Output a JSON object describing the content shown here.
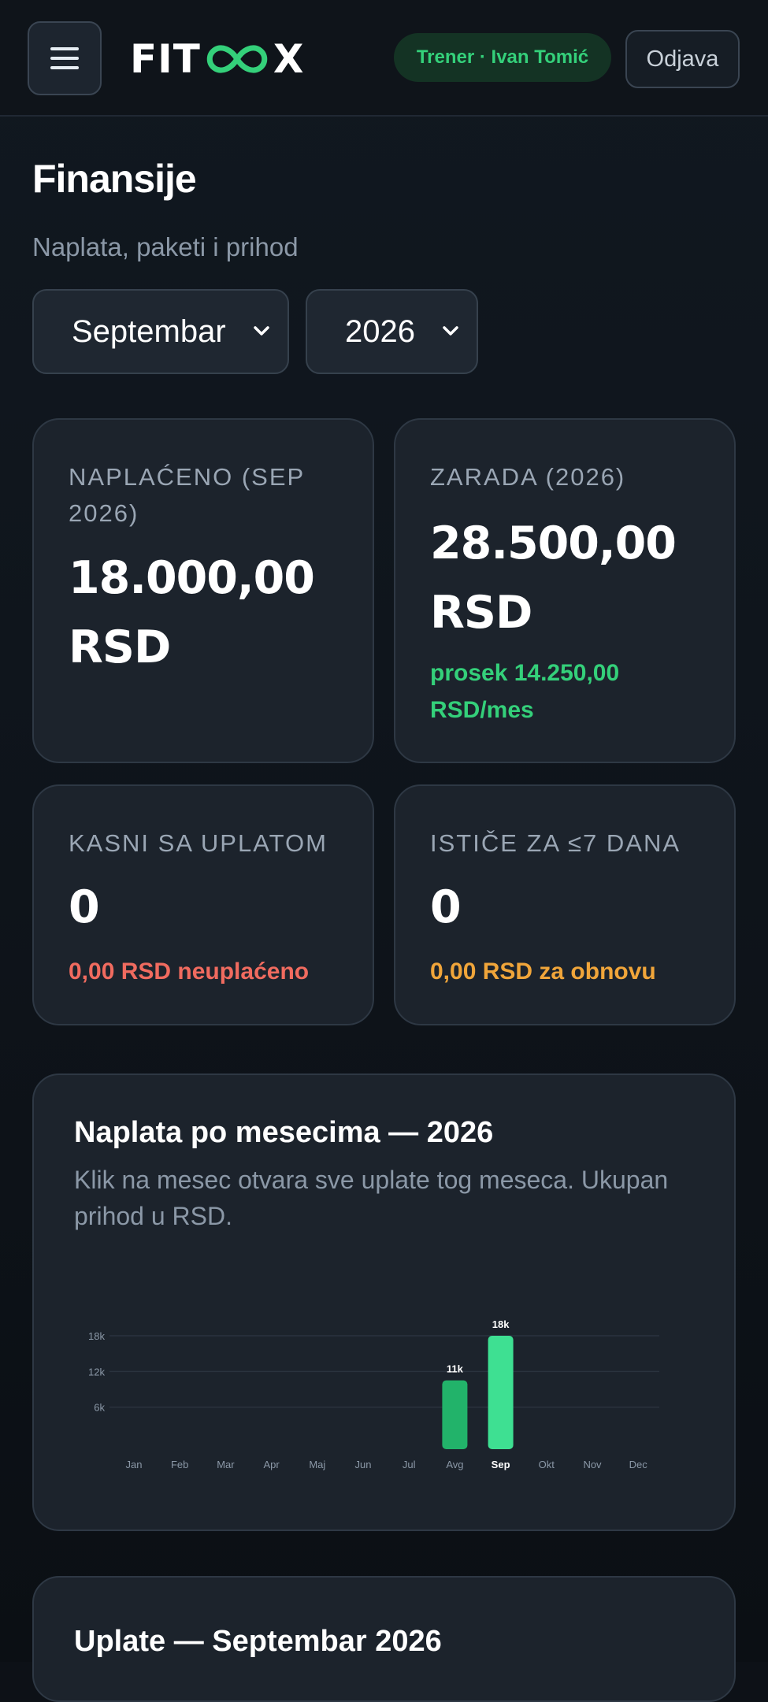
{
  "header": {
    "logo_left": "FIT",
    "logo_right": "X",
    "user_badge": "Trener · Ivan Tomić",
    "logout_label": "Odjava"
  },
  "page": {
    "title": "Finansije",
    "subtitle": "Naplata, paketi i prihod",
    "month_select": "Septembar",
    "year_select": "2026"
  },
  "stats": {
    "collected": {
      "label": "NAPLAĆENO (SEP 2026)",
      "value": "18.000,00 RSD"
    },
    "earnings": {
      "label": "ZARADA (2026)",
      "value": "28.500,00 RSD",
      "note": "prosek 14.250,00 RSD/mes"
    },
    "late": {
      "label": "KASNI SA UPLATOM",
      "value": "0",
      "note": "0,00 RSD neuplaćeno"
    },
    "expiring": {
      "label": "ISTIČE ZA ≤7 DANA",
      "value": "0",
      "note": "0,00 RSD za obnovu"
    }
  },
  "chart_section": {
    "title": "Naplata po mesecima — 2026",
    "subtitle": "Klik na mesec otvara sve uplate tog meseca. Ukupan prihod u RSD."
  },
  "chart_data": {
    "type": "bar",
    "categories": [
      "Jan",
      "Feb",
      "Mar",
      "Apr",
      "Maj",
      "Jun",
      "Jul",
      "Avg",
      "Sep",
      "Okt",
      "Nov",
      "Dec"
    ],
    "values": [
      0,
      0,
      0,
      0,
      0,
      0,
      0,
      10500,
      18000,
      0,
      0,
      0
    ],
    "data_labels": [
      "",
      "",
      "",
      "",
      "",
      "",
      "",
      "11k",
      "18k",
      "",
      "",
      ""
    ],
    "ytick_labels": [
      "6k",
      "12k",
      "18k"
    ],
    "yticks": [
      6000,
      12000,
      18000
    ],
    "ylim": [
      0,
      18000
    ],
    "selected": "Sep",
    "colors": {
      "bar": "#22b36a",
      "selected_bar": "#3ee092",
      "grid": "#2a333e",
      "tick": "#8b98a7"
    }
  },
  "payments_section": {
    "title": "Uplate — Septembar 2026"
  }
}
